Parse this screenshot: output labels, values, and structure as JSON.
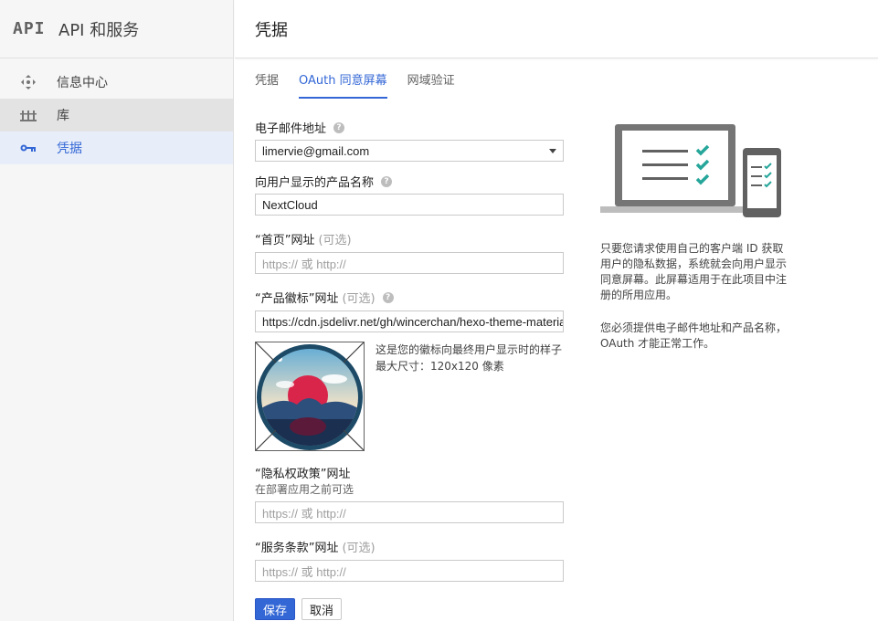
{
  "brand": {
    "logo": "API",
    "title": "API 和服务"
  },
  "sidebar": {
    "items": [
      {
        "label": "信息中心",
        "icon": "dashboard-icon"
      },
      {
        "label": "库",
        "icon": "library-icon"
      },
      {
        "label": "凭据",
        "icon": "key-icon"
      }
    ]
  },
  "header": {
    "title": "凭据"
  },
  "tabs": [
    {
      "label": "凭据"
    },
    {
      "label": "OAuth 同意屏幕",
      "active": true
    },
    {
      "label": "网域验证"
    }
  ],
  "form": {
    "email": {
      "label": "电子邮件地址",
      "value": "limervie@gmail.com"
    },
    "product_name": {
      "label": "向用户显示的产品名称",
      "value": "NextCloud"
    },
    "homepage": {
      "label": "“首页”网址",
      "optional": "(可选)",
      "placeholder": "https:// 或 http://"
    },
    "logo_url": {
      "label": "“产品徽标”网址",
      "optional": "(可选)",
      "value": "https://cdn.jsdelivr.net/gh/wincerchan/hexo-theme-material@"
    },
    "logo_caption": {
      "line1": "这是您的徽标向最终用户显示时的样子",
      "line2": "最大尺寸：120x120 像素"
    },
    "privacy": {
      "label": "“隐私权政策”网址",
      "sublabel": "在部署应用之前可选",
      "placeholder": "https:// 或 http://"
    },
    "tos": {
      "label": "“服务条款”网址",
      "optional": "(可选)",
      "placeholder": "https:// 或 http://"
    },
    "save_label": "保存",
    "cancel_label": "取消"
  },
  "info": {
    "paragraph1": "只要您请求使用自己的客户端 ID 获取用户的隐私数据，系统就会向用户显示同意屏幕。此屏幕适用于在此项目中注册的所用应用。",
    "paragraph2": "您必须提供电子邮件地址和产品名称，OAuth 才能正常工作。"
  },
  "colors": {
    "accent": "#3367d6",
    "check": "#26a69a"
  }
}
